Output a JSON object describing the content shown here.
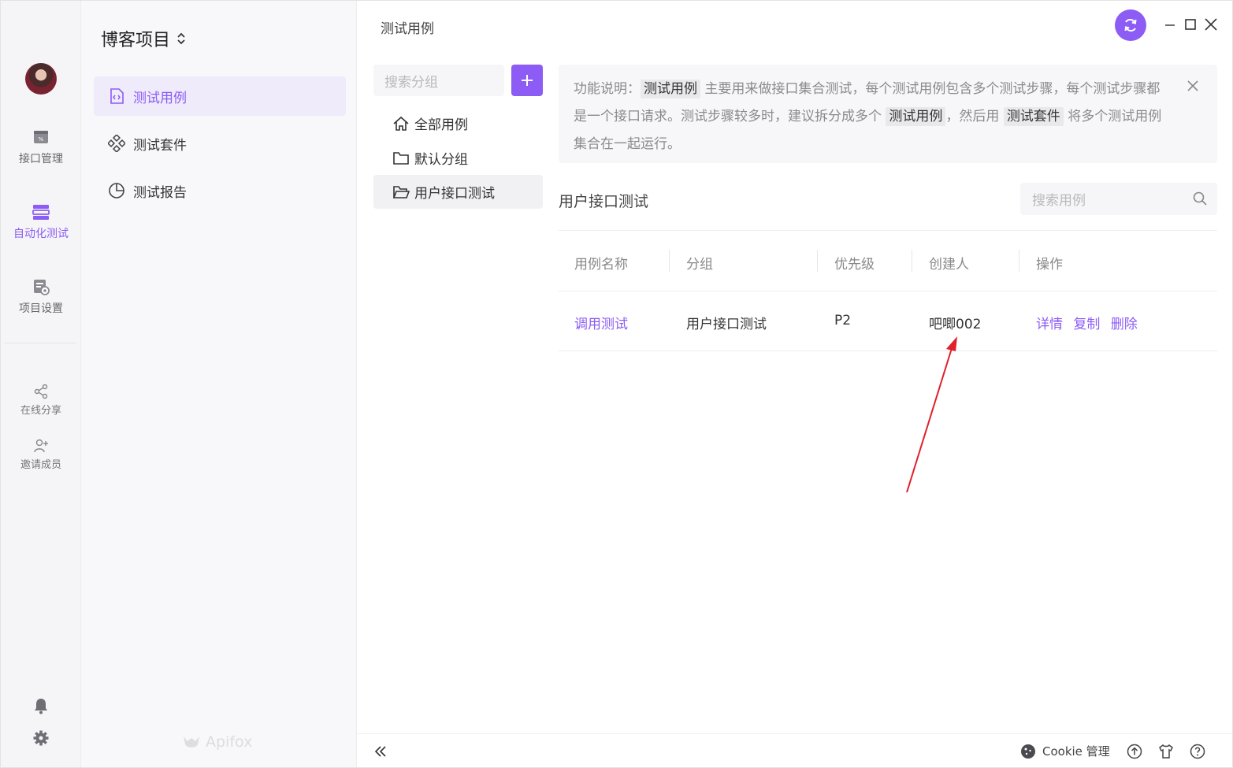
{
  "rail": {
    "items": [
      {
        "label": "接口管理",
        "icon": "api-icon"
      },
      {
        "label": "自动化测试",
        "icon": "automation-icon"
      },
      {
        "label": "项目设置",
        "icon": "project-settings-icon"
      }
    ],
    "share_label": "在线分享",
    "invite_label": "邀请成员"
  },
  "nav": {
    "project": "博客项目",
    "items": [
      {
        "label": "测试用例"
      },
      {
        "label": "测试套件"
      },
      {
        "label": "测试报告"
      }
    ],
    "brand": "Apifox"
  },
  "main": {
    "breadcrumb": "测试用例",
    "group_search_placeholder": "搜索分组",
    "groups": [
      {
        "label": "全部用例"
      },
      {
        "label": "默认分组"
      },
      {
        "label": "用户接口测试"
      }
    ],
    "notice": {
      "prefix": "功能说明：",
      "tag1": "测试用例",
      "text1": " 主要用来做接口集合测试，每个测试用例包含多个测试步骤，每个测试步骤都是一个接口请求。测试步骤较多时，建议拆分成多个 ",
      "tag2": "测试用例",
      "text2": "，然后用 ",
      "tag3": "测试套件",
      "text3": " 将多个测试用例集合在一起运行。"
    },
    "section_title": "用户接口测试",
    "case_search_placeholder": "搜索用例",
    "table": {
      "headers": [
        "用例名称",
        "分组",
        "优先级",
        "创建人",
        "操作"
      ],
      "rows": [
        {
          "name": "调用测试",
          "group": "用户接口测试",
          "priority": "P2",
          "creator": "吧唧002",
          "ops": [
            "详情",
            "复制",
            "删除"
          ]
        }
      ]
    },
    "footer": {
      "cookie_label": "Cookie 管理"
    }
  },
  "colors": {
    "accent": "#8c5cf5",
    "arrow": "#e0202a"
  }
}
